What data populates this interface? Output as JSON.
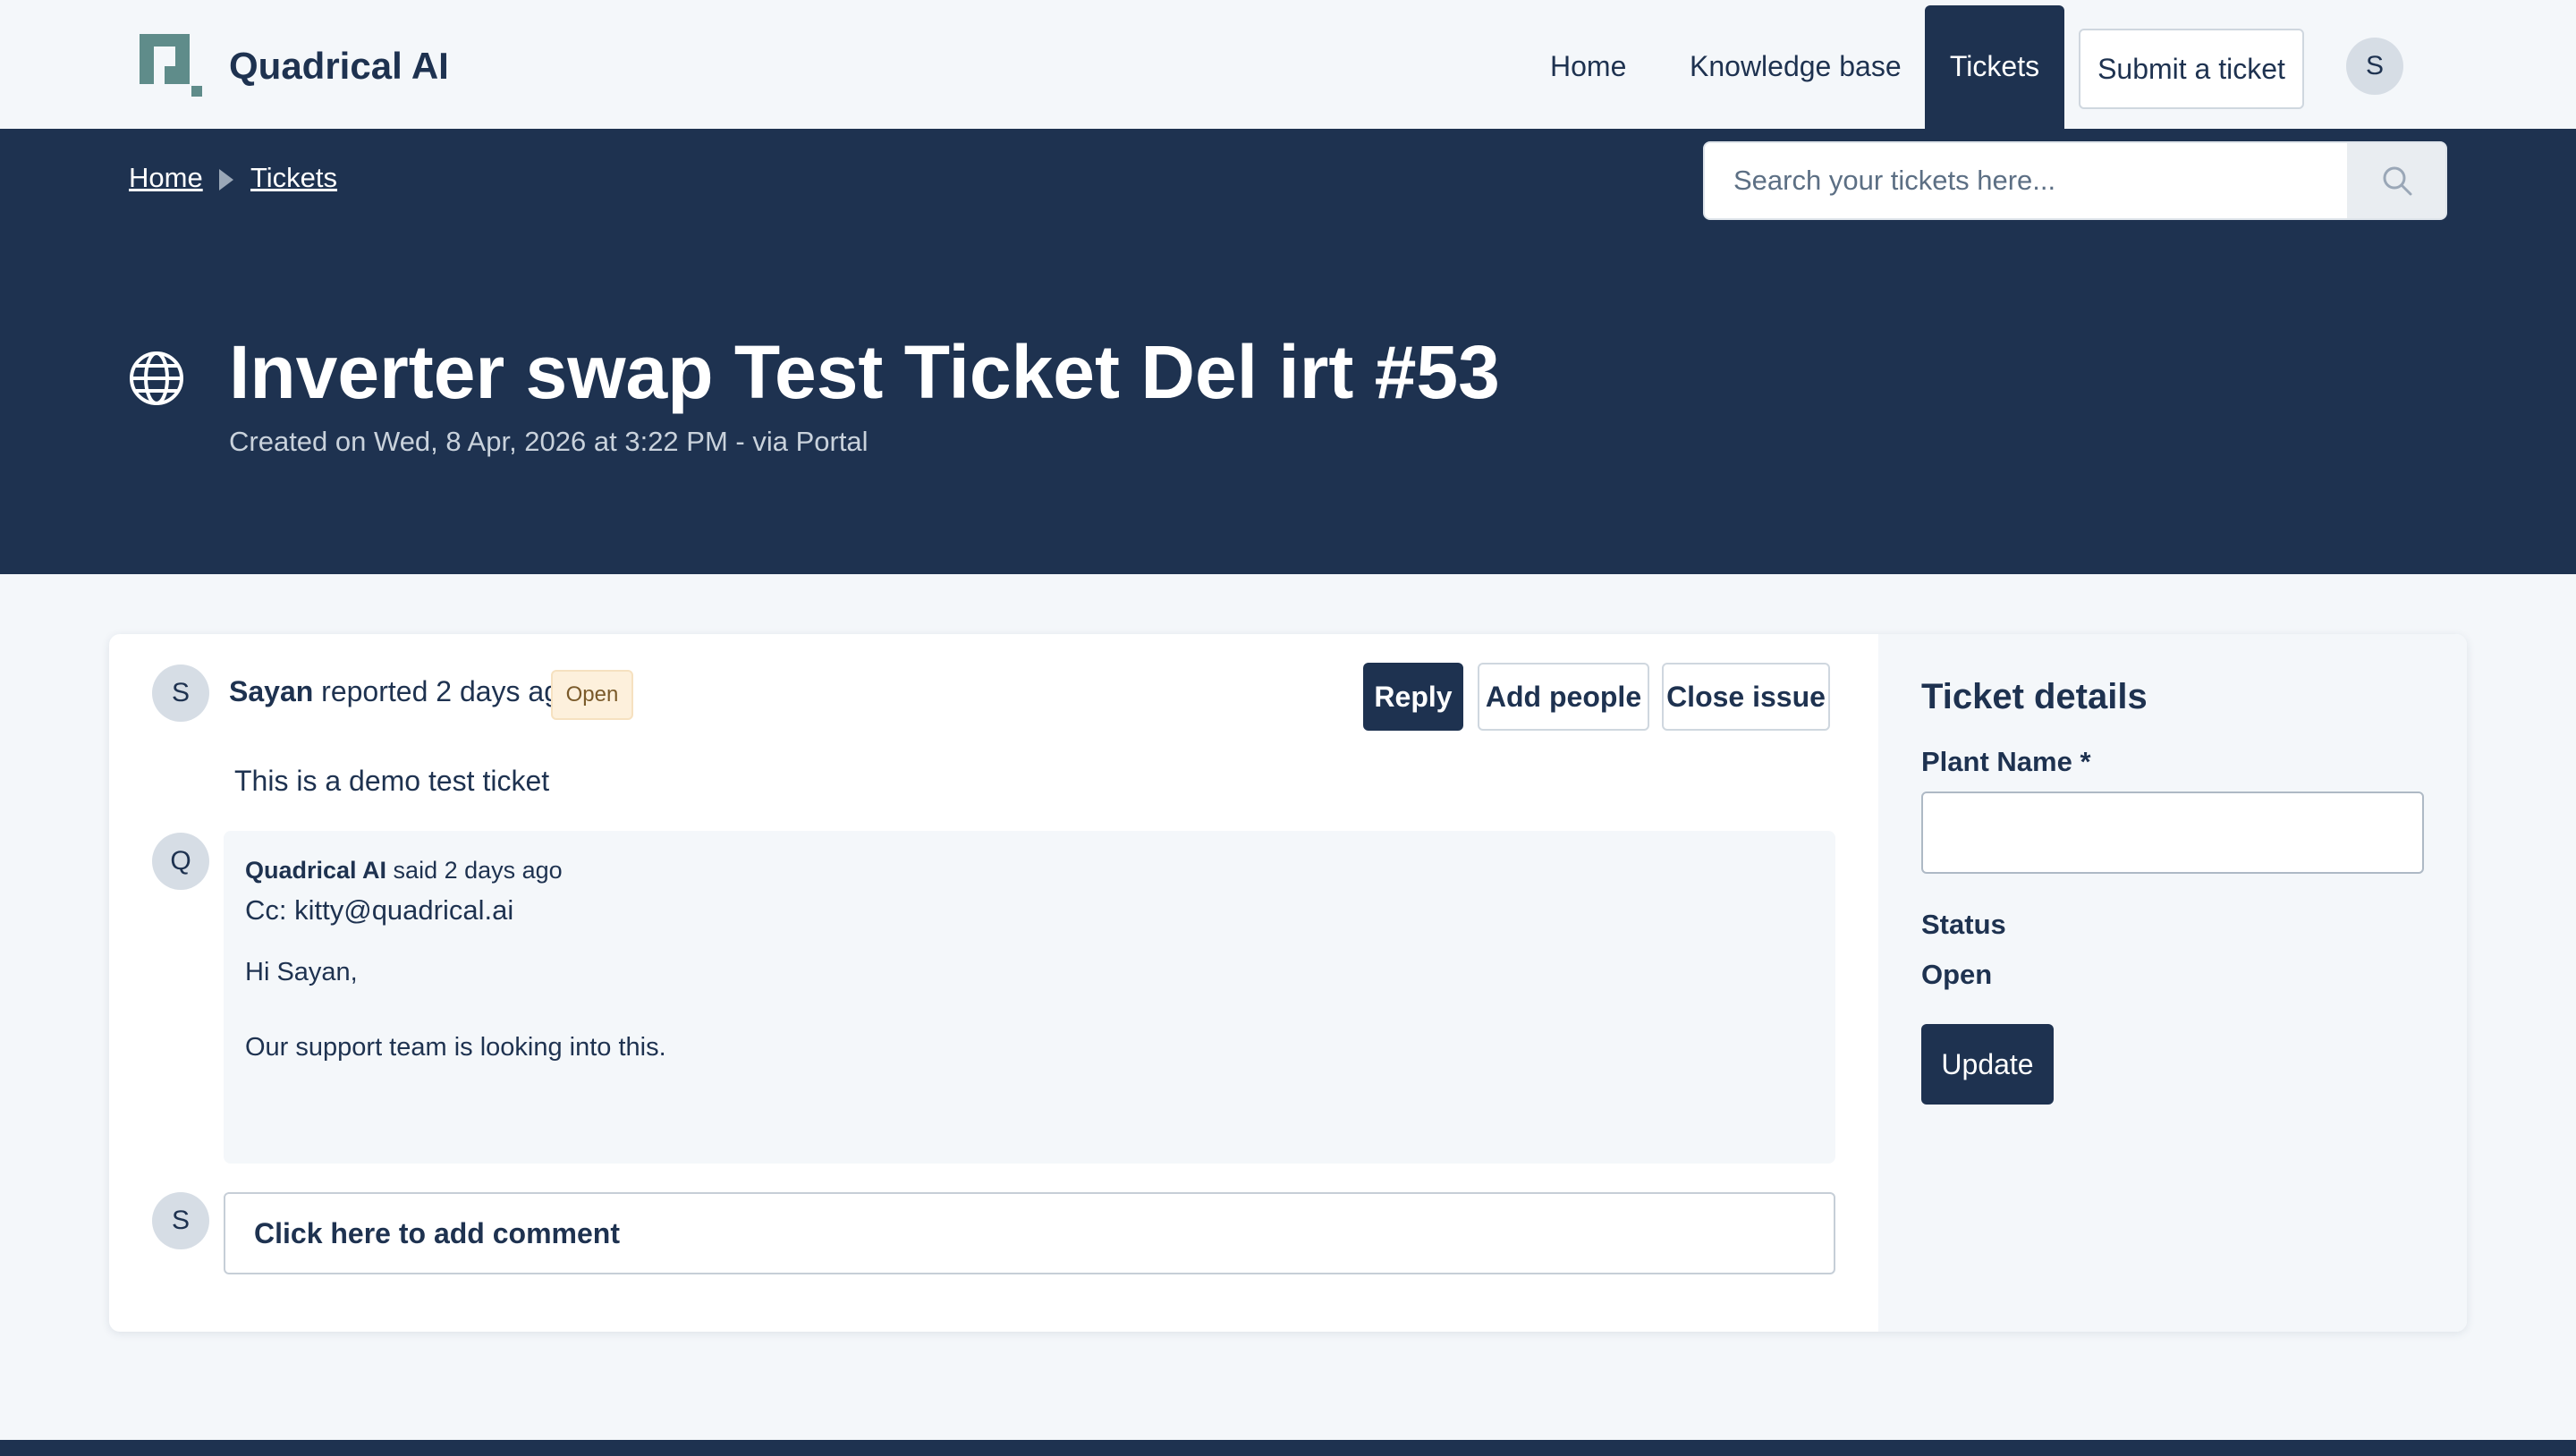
{
  "header": {
    "brand": "Quadrical AI",
    "nav": {
      "home": "Home",
      "knowledge_base": "Knowledge base",
      "tickets": "Tickets",
      "submit": "Submit a ticket"
    },
    "user_initial": "S"
  },
  "breadcrumb": {
    "home": "Home",
    "tickets": "Tickets"
  },
  "search": {
    "placeholder": "Search your tickets here..."
  },
  "ticket": {
    "title": "Inverter swap Test Ticket Del irt #53",
    "created": "Created on Wed, 8 Apr, 2026 at 3:22 PM - via Portal",
    "reporter_initial": "S",
    "reporter_name": "Sayan",
    "reported_text": " reported 2 days ago",
    "status_badge": "Open",
    "description": "This is a demo test ticket"
  },
  "actions": {
    "reply": "Reply",
    "add_people": "Add people",
    "close_issue": "Close issue"
  },
  "reply": {
    "initial": "Q",
    "author": "Quadrical AI",
    "said_text": " said 2 days ago",
    "cc": "Cc: kitty@quadrical.ai",
    "line1": "Hi Sayan,",
    "line2": "Our support team is looking into this."
  },
  "comment": {
    "initial": "S",
    "placeholder": "Click here to add comment"
  },
  "details": {
    "title": "Ticket details",
    "plant_name_label": "Plant Name *",
    "plant_name_value": "",
    "status_label": "Status",
    "status_value": "Open",
    "update_button": "Update"
  },
  "colors": {
    "primary": "#1e3250",
    "background": "#f4f7fa",
    "badge_bg": "#fdf0dc",
    "logo": "#5f8c8a"
  }
}
